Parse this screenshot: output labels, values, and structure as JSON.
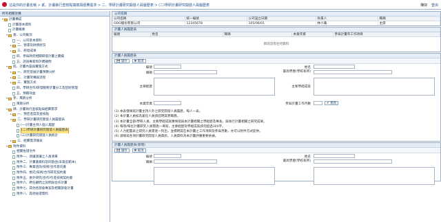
{
  "header": {
    "breadcrumb": "這是你的計畫名稱 > 貳、計畫執行查核點填寫與經費需求 > 二、學研計畫研究開發人員履歷表 > (二)學研計畫研究開發人員履歷表",
    "user": "陳好",
    "logout": "登出"
  },
  "sidebar": {
    "title": "所有相關架構",
    "items": [
      {
        "label": "計畫構成",
        "level": 0,
        "tw": "▾",
        "kind": "folder"
      },
      {
        "label": "計畫基本資料",
        "level": 1,
        "tw": "",
        "kind": "doc"
      },
      {
        "label": "計畫概要",
        "level": 1,
        "tw": "",
        "kind": "doc"
      },
      {
        "label": "壹、公司概況",
        "level": 1,
        "tw": "▾",
        "kind": "folder"
      },
      {
        "label": "一、公司基本資料",
        "level": 2,
        "tw": "",
        "kind": "doc"
      },
      {
        "label": "二、營運及財務狀況",
        "level": 2,
        "tw": "▸",
        "kind": "folder"
      },
      {
        "label": "三、研發成果",
        "level": 2,
        "tw": "▸",
        "kind": "folder"
      },
      {
        "label": "四、參與政府相關研發計畫之實績",
        "level": 2,
        "tw": "",
        "kind": "doc"
      },
      {
        "label": "五、諮詢專家和外聘顧問",
        "level": 2,
        "tw": "",
        "kind": "doc"
      },
      {
        "label": "貳、計畫內容與實施方式",
        "level": 1,
        "tw": "▾",
        "kind": "folder"
      },
      {
        "label": "一、研究發展計畫預算分析",
        "level": 2,
        "tw": "▸",
        "kind": "folder"
      },
      {
        "label": "二、計畫架構與流程",
        "level": 2,
        "tw": "▸",
        "kind": "folder"
      },
      {
        "label": "三、實施方式",
        "level": 2,
        "tw": "▸",
        "kind": "folder"
      },
      {
        "label": "四、學研合作/研發服務計畫分工及智財管理",
        "level": 2,
        "tw": "",
        "kind": "doc"
      },
      {
        "label": "五、預期效益",
        "level": 2,
        "tw": "",
        "kind": "doc"
      },
      {
        "label": "參、風險分析",
        "level": 1,
        "tw": "▾",
        "kind": "folder"
      },
      {
        "label": "風險分析",
        "level": 2,
        "tw": "",
        "kind": "doc"
      },
      {
        "label": "肆、計畫執行查核點與經費需求",
        "level": 1,
        "tw": "▾",
        "kind": "folder"
      },
      {
        "label": "一、預定進度及查核點",
        "level": 2,
        "tw": "▸",
        "kind": "folder"
      },
      {
        "label": "二、學研計畫研究開發人員履歷表",
        "level": 2,
        "tw": "▾",
        "kind": "folder"
      },
      {
        "label": "(一)計畫主持人個人履歷",
        "level": 3,
        "tw": "",
        "kind": "doc"
      },
      {
        "label": "(二)學研計畫研究開發人員履歷表",
        "level": 3,
        "tw": "",
        "kind": "doc",
        "sel": true
      },
      {
        "label": "(三)計畫研究開發人員統計",
        "level": 3,
        "tw": "",
        "kind": "doc"
      },
      {
        "label": "三、經費需求總表",
        "level": 2,
        "tw": "▸",
        "kind": "folder"
      },
      {
        "label": "附件資料",
        "level": 1,
        "tw": "▾",
        "kind": "folder"
      },
      {
        "label": "相關佐證文件",
        "level": 2,
        "tw": "",
        "kind": "doc"
      },
      {
        "label": "附件一、須讓渡讓之人員清單",
        "level": 2,
        "tw": "",
        "kind": "doc"
      },
      {
        "label": "附件二、計畫書資料及同意函(未簽前範本)",
        "level": 2,
        "tw": "",
        "kind": "doc"
      },
      {
        "label": "附件三、專業諮詢/技術/合作意向書",
        "level": 2,
        "tw": "",
        "kind": "doc"
      },
      {
        "label": "附件四、委託/技術/合作研究契約書",
        "level": 2,
        "tw": "",
        "kind": "doc"
      },
      {
        "label": "附件五、委外研究/合作/引進技術契約書",
        "level": 2,
        "tw": "",
        "kind": "doc"
      },
      {
        "label": "附件六、聘任顧問之說明與合作計畫",
        "level": 2,
        "tw": "",
        "kind": "doc"
      },
      {
        "label": "附件七、其他各部會專案及相關部會計畫",
        "level": 2,
        "tw": "",
        "kind": "doc"
      },
      {
        "label": "附件八、其他佐證資料",
        "level": 2,
        "tw": "",
        "kind": "doc"
      }
    ]
  },
  "company": {
    "title": "公司名稱",
    "headers": [
      "公司名稱",
      "統一編號",
      "公司設立日期",
      "負責人",
      "職稱"
    ],
    "row": [
      "OOO股份有限公司",
      "12345678",
      "105/06/01",
      "林小萬",
      "主席"
    ]
  },
  "list": {
    "title": "計畫人員履歷表",
    "headers": [
      "編號",
      "姓名",
      "職稱",
      "本業年資",
      "參與計畫年工作項目"
    ],
    "empty": "目前沒有任何資料"
  },
  "form1": {
    "title": "計畫人員履歷表",
    "save": "儲存",
    "cancel": "取消",
    "labels": {
      "id": "編號",
      "name": "姓名",
      "title": "職稱",
      "degree": "最高學歷(學校系所)",
      "experience": "主要經歷",
      "achievements": "主要學經成就",
      "years": "本業年資",
      "months": "參與計畫工作月數",
      "query": "查詢"
    }
  },
  "notes": [
    "(1) 本表僅填寫計畫主持人外之研究開發人員履歷，每人一表。",
    "(2) 本計畫人員如為兼任人員請註明其原職務。",
    "(3) 本計畫全部/學研人員、主要學經成就應填寫與本計畫相關之學經歷及專長，與執行計畫相關之研究成果。",
    "(4) 每項/每位計畫研究人員需逐一填寫，主要經歷及學經成就請勿超過300字。",
    "(5) 人力配置表之研究人員需逐一列出，並標明其在本計畫之工作項目及參與月數，亦可以附件方式提供。",
    "(6) 請填寫各項計畫研究開發人員資訊，人員資料為本計畫評審重要依據。"
  ],
  "form2": {
    "title": "計畫人員履歷表(新增)",
    "save": "儲存",
    "cancel": "取消",
    "labels": {
      "id": "編號",
      "name": "姓名",
      "title": "職稱",
      "degree": "最高學歷(學校系所)"
    }
  }
}
